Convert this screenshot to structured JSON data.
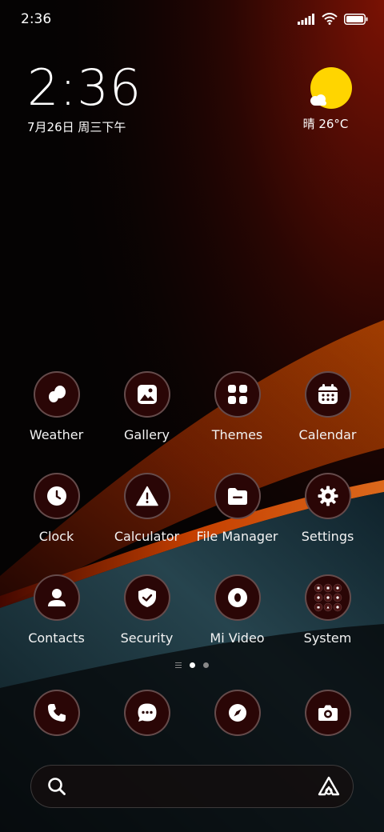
{
  "status_bar": {
    "time": "2:36"
  },
  "clock_widget": {
    "time": "2:36",
    "date": "7月26日 周三下午"
  },
  "weather_widget": {
    "text": "晴 26°C"
  },
  "apps": [
    {
      "label": "Weather"
    },
    {
      "label": "Gallery"
    },
    {
      "label": "Themes"
    },
    {
      "label": "Calendar"
    },
    {
      "label": "Clock"
    },
    {
      "label": "Calculator"
    },
    {
      "label": "File Manager"
    },
    {
      "label": "Settings"
    },
    {
      "label": "Contacts"
    },
    {
      "label": "Security"
    },
    {
      "label": "Mi Video"
    },
    {
      "label": "System"
    }
  ],
  "page_indicator": {
    "pages": 2,
    "current": 1
  },
  "dock": [
    "phone-icon",
    "messages-icon",
    "browser-icon",
    "camera-icon"
  ],
  "colors": {
    "accent_orange": "#ff5a00",
    "icon_bg": "#2a0606",
    "sun": "#ffd500"
  }
}
